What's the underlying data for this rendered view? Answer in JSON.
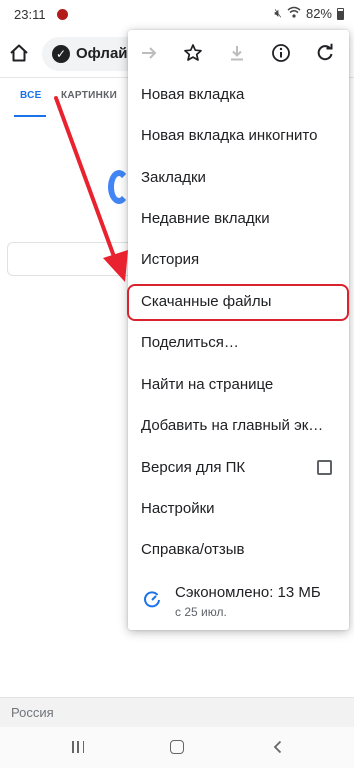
{
  "status_bar": {
    "time": "23:11",
    "battery": "82%",
    "icons": [
      "mute-icon",
      "wifi-icon",
      "battery-icon"
    ]
  },
  "toolbar": {
    "omnibox_text": "Офлайн"
  },
  "search_tabs": {
    "all": "ВСЕ",
    "images": "КАРТИНКИ"
  },
  "menu": {
    "top_icons": [
      "forward-icon",
      "bookmark-star-icon",
      "download-icon",
      "info-icon",
      "refresh-icon"
    ],
    "items": [
      {
        "label": "Новая вкладка"
      },
      {
        "label": "Новая вкладка инкогнито"
      },
      {
        "label": "Закладки"
      },
      {
        "label": "Недавние вкладки"
      },
      {
        "label": "История"
      },
      {
        "label": "Скачанные файлы"
      },
      {
        "label": "Поделиться…"
      },
      {
        "label": "Найти на странице"
      },
      {
        "label": "Добавить на главный эк…"
      },
      {
        "label": "Версия для ПК",
        "checked": false
      },
      {
        "label": "Настройки"
      },
      {
        "label": "Справка/отзыв"
      }
    ],
    "savings": {
      "title": "Сэкономлено: 13 МБ",
      "subtitle": "с 25 июл."
    }
  },
  "footer": {
    "region": "Россия"
  },
  "colors": {
    "accent": "#1a73e8",
    "annotation": "#d9232f"
  }
}
